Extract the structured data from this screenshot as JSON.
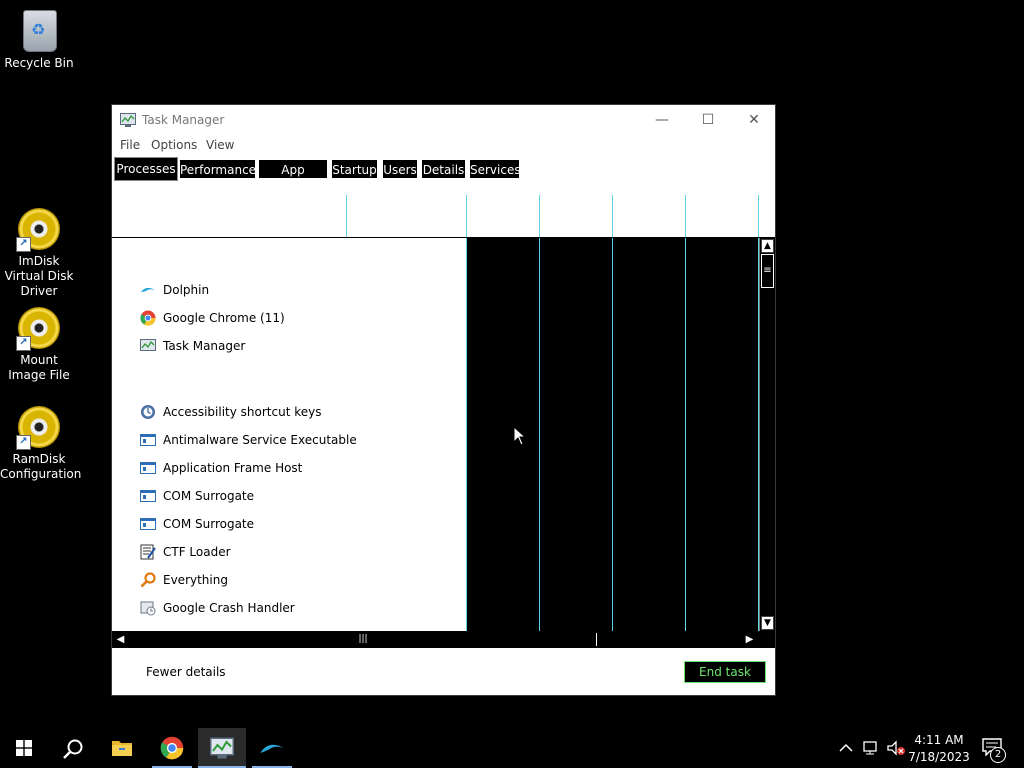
{
  "desktop": {
    "icons": [
      {
        "label": "Recycle Bin",
        "icon": "recycle-bin-icon"
      },
      {
        "label": "ImDisk Virtual Disk Driver",
        "icon": "disk-shortcut-icon"
      },
      {
        "label": "Mount Image File",
        "icon": "disk-shortcut-icon"
      },
      {
        "label": "RamDisk Configuration",
        "icon": "disk-shortcut-icon"
      }
    ]
  },
  "window": {
    "title": "Task Manager",
    "controls": {
      "minimize": "—",
      "maximize": "☐",
      "close": "✕"
    },
    "menu": [
      "File",
      "Options",
      "View"
    ],
    "tabs": [
      "Processes",
      "Performance",
      "App history",
      "Startup",
      "Users",
      "Details",
      "Services"
    ],
    "active_tab": "Processes",
    "processes": [
      {
        "name": "Dolphin",
        "icon": "dolphin-icon"
      },
      {
        "name": "Google Chrome (11)",
        "icon": "chrome-icon"
      },
      {
        "name": "Task Manager",
        "icon": "task-manager-icon"
      },
      {
        "name": "Accessibility shortcut keys",
        "icon": "accessibility-icon"
      },
      {
        "name": "Antimalware Service Executable",
        "icon": "service-window-icon"
      },
      {
        "name": "Application Frame Host",
        "icon": "service-window-icon"
      },
      {
        "name": "COM Surrogate",
        "icon": "service-window-icon"
      },
      {
        "name": "COM Surrogate",
        "icon": "service-window-icon"
      },
      {
        "name": "CTF Loader",
        "icon": "ctf-loader-icon"
      },
      {
        "name": "Everything",
        "icon": "everything-search-icon"
      },
      {
        "name": "Google Crash Handler",
        "icon": "crash-handler-icon"
      }
    ],
    "footer": {
      "fewer_details": "Fewer details",
      "end_task": "End task"
    }
  },
  "taskbar": {
    "apps": [
      "start-icon",
      "search-icon",
      "file-explorer-icon",
      "chrome-icon",
      "task-manager-icon",
      "dolphin-icon"
    ],
    "clock": {
      "time": "4:11 AM",
      "date": "7/18/2023"
    },
    "notification_count": "2"
  },
  "colors": {
    "accent_cyan": "#5fd3e6",
    "end_task_green": "#6ee56e",
    "desktop_bg": "#000000"
  }
}
